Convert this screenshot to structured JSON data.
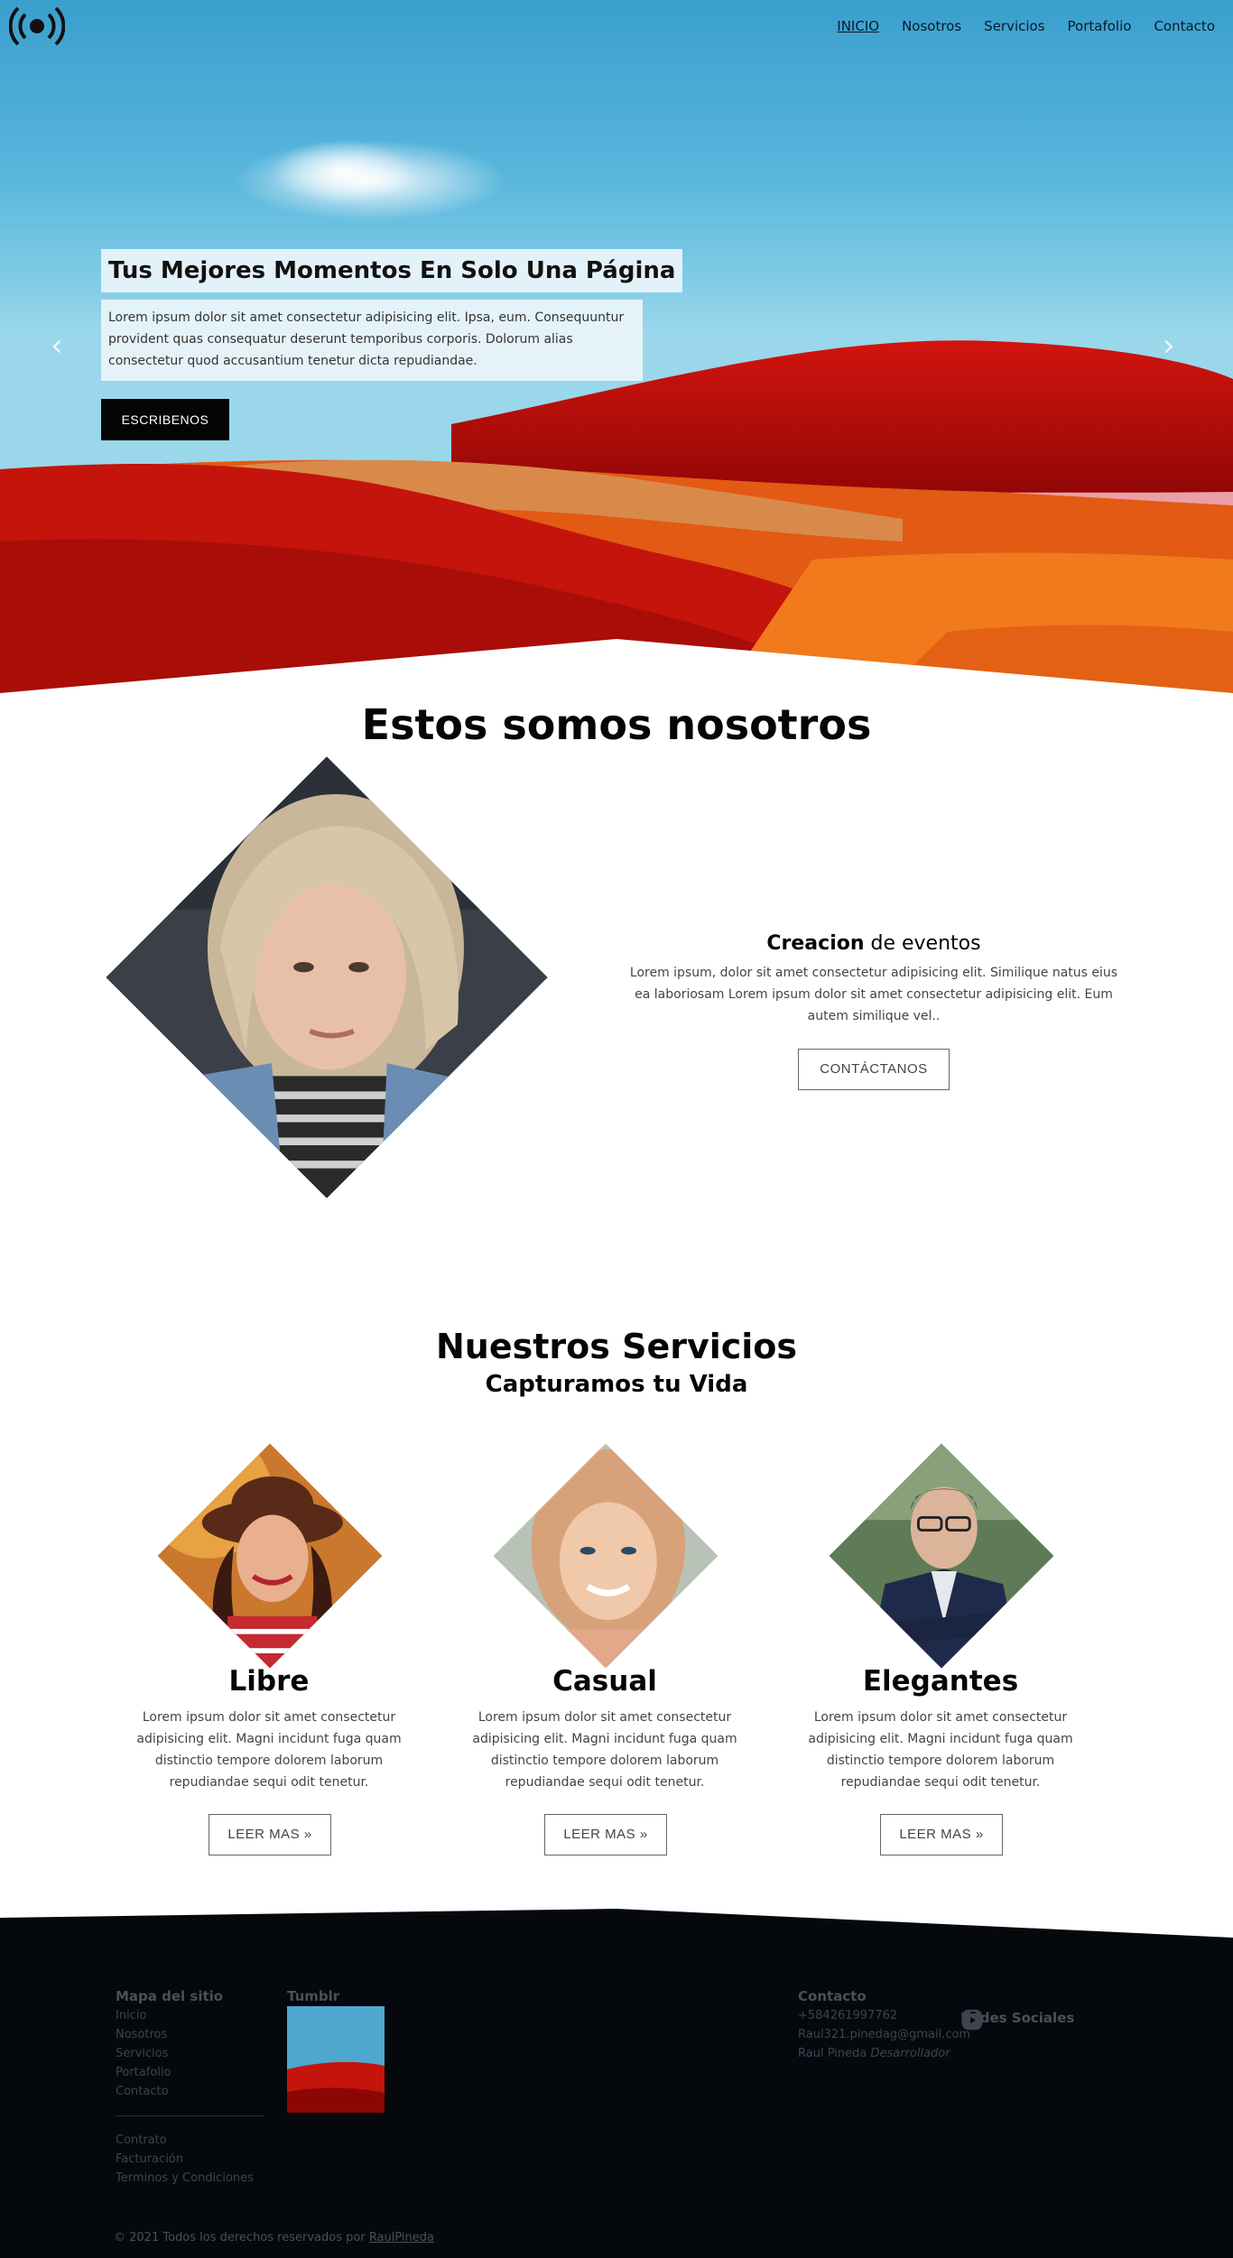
{
  "nav": {
    "items": [
      "INICIO",
      "Nosotros",
      "Servicios",
      "Portafolio",
      "Contacto"
    ],
    "active": "INICIO"
  },
  "hero": {
    "title": "Tus Mejores Momentos En Solo Una Página",
    "text": "Lorem ipsum dolor sit amet consectetur adipisicing elit. Ipsa, eum. Consequuntur provident quas consequatur deserunt temporibus corporis. Dolorum alias consectetur quod accusantium tenetur dicta repudiandae.",
    "button": "ESCRIBENOS",
    "prev_icon": "chevron-left-icon",
    "next_icon": "chevron-right-icon"
  },
  "about": {
    "title": "Estos somos nosotros",
    "heading_bold": "Creacion",
    "heading_rest": " de eventos",
    "text": "Lorem ipsum, dolor sit amet consectetur adipisicing elit. Similique natus eius ea laboriosam Lorem ipsum dolor sit amet consectetur adipisicing elit. Eum autem similique vel..",
    "button": "CONTÁCTANOS"
  },
  "services": {
    "title": "Nuestros Servicios",
    "subtitle_plain": "Capturamos tu ",
    "subtitle_bold": "Vida",
    "cards": [
      {
        "title": "Libre",
        "text": "Lorem ipsum dolor sit amet consectetur adipisicing elit. Magni incidunt fuga quam distinctio tempore dolorem laborum repudiandae sequi odit tenetur.",
        "button": "LEER MAS »"
      },
      {
        "title": "Casual",
        "text": "Lorem ipsum dolor sit amet consectetur adipisicing elit. Magni incidunt fuga quam distinctio tempore dolorem laborum repudiandae sequi odit tenetur.",
        "button": "LEER MAS »"
      },
      {
        "title": "Elegantes",
        "text": "Lorem ipsum dolor sit amet consectetur adipisicing elit. Magni incidunt fuga quam distinctio tempore dolorem laborum repudiandae sequi odit tenetur.",
        "button": "LEER MAS »"
      }
    ]
  },
  "footer": {
    "sitemap_title": "Mapa del sitio",
    "sitemap": [
      "Inicio",
      "Nosotros",
      "Servicios",
      "Portafolio",
      "Contacto"
    ],
    "legal": [
      "Contrato",
      "Facturación",
      "Terminos y Condiciones"
    ],
    "tumblr_title": "Tumblr",
    "contact_title": "Contacto",
    "phone": "+584261997762",
    "email": "Raul321.pinedag@gmail.com",
    "author_name": "Raul Pineda",
    "author_role": "Desarrollador",
    "social_title": "Redes Sociales",
    "social_icons": [
      "facebook-icon",
      "twitter-icon",
      "instagram-icon",
      "youtube-icon"
    ],
    "copyright": "© 2021 Todos los derechos reservados por",
    "copyright_link": "RaulPineda"
  },
  "colors": {
    "hero_sky": "#4fb0d9",
    "hero_red": "#c8150c",
    "footer_bg": "#05080d",
    "button_dark": "#050505"
  }
}
